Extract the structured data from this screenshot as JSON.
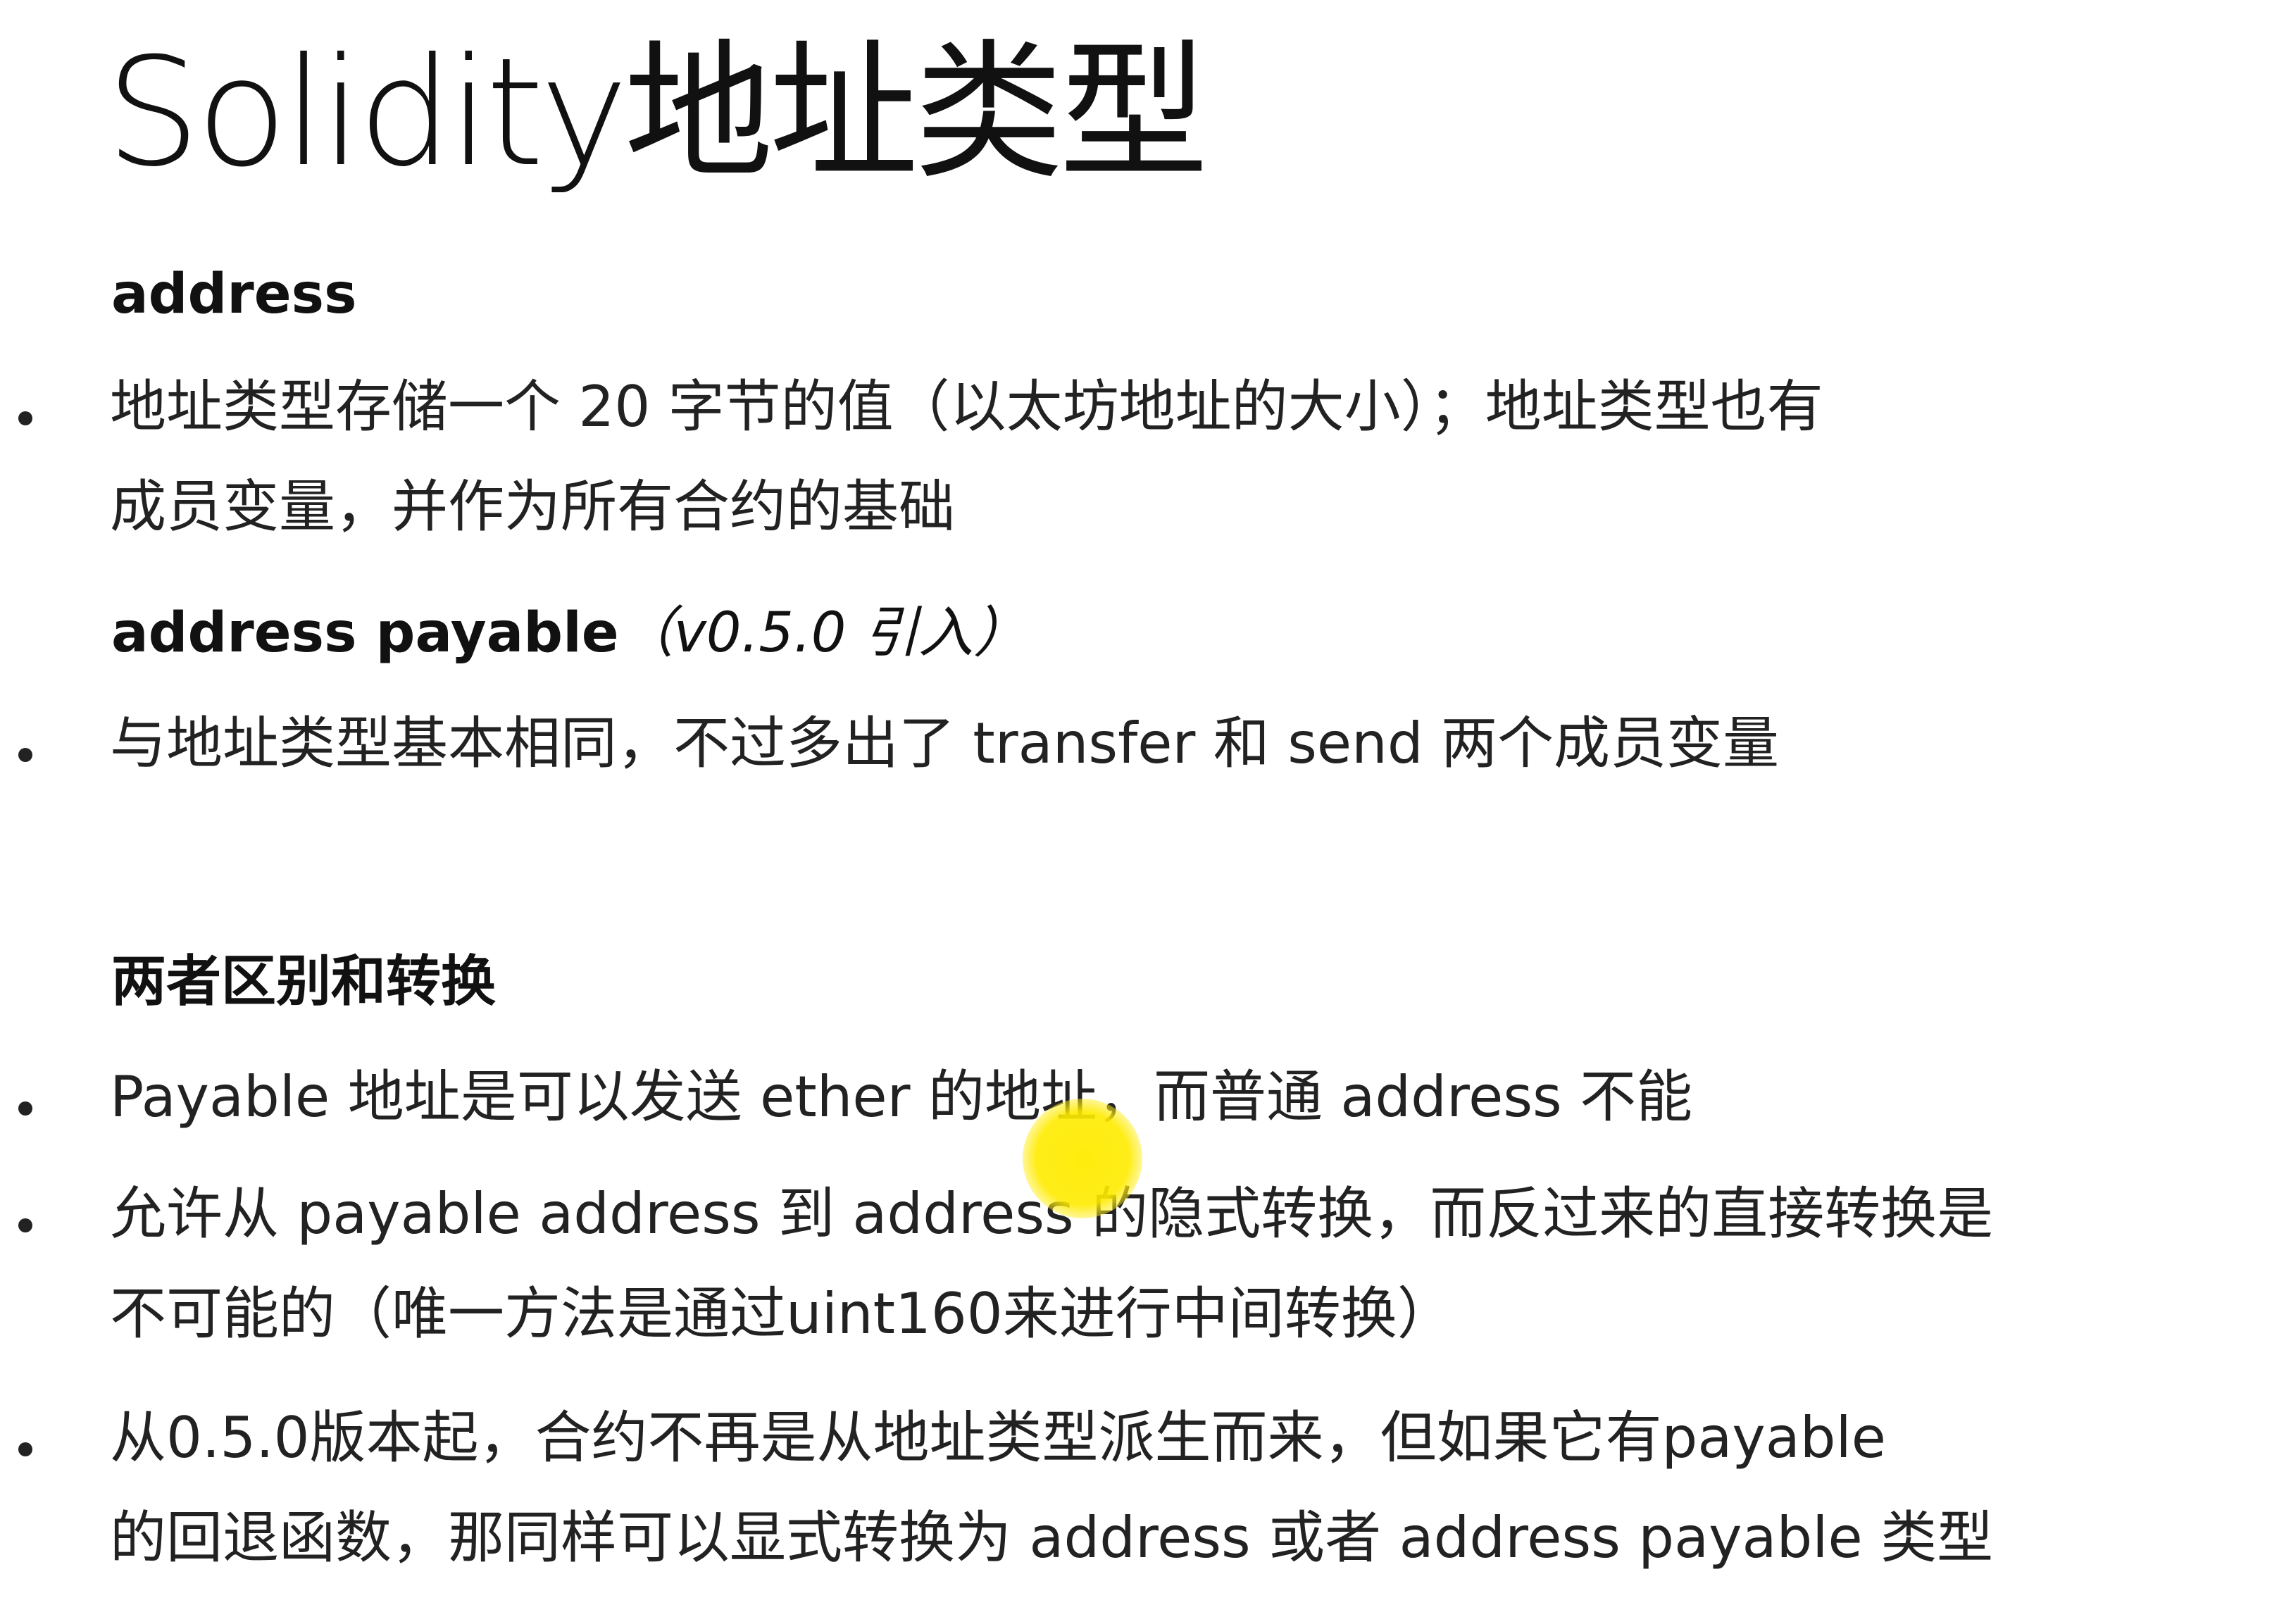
{
  "title": "Solidity地址类型",
  "section1": {
    "heading": "address",
    "bullet": {
      "line1": "地址类型存储一个 20 字节的值（以太坊地址的大小）；地址类型也有",
      "line2": "成员变量，并作为所有合约的基础"
    }
  },
  "section2": {
    "heading": "address payable",
    "heading_tail": "（v0.5.0 引入）",
    "bullet": {
      "line1": "与地址类型基本相同，不过多出了 transfer 和 send 两个成员变量"
    }
  },
  "section3": {
    "heading": "两者区别和转换",
    "bullets": [
      {
        "line1": "Payable 地址是可以发送 ether 的地址，而普通 address 不能"
      },
      {
        "line1": "允许从 payable address 到 address 的隐式转换，而反过来的直接转换是",
        "line2": "不可能的（唯一方法是通过uint160来进行中间转换）"
      },
      {
        "line1": "从0.5.0版本起，合约不再是从地址类型派生而来，但如果它有payable",
        "line2": "的回退函数，那同样可以显式转换为 address 或者 address payable 类型"
      }
    ]
  },
  "colors": {
    "background": "#ffffff",
    "text": "#222222",
    "cursor_highlight": "#ffeb00"
  }
}
